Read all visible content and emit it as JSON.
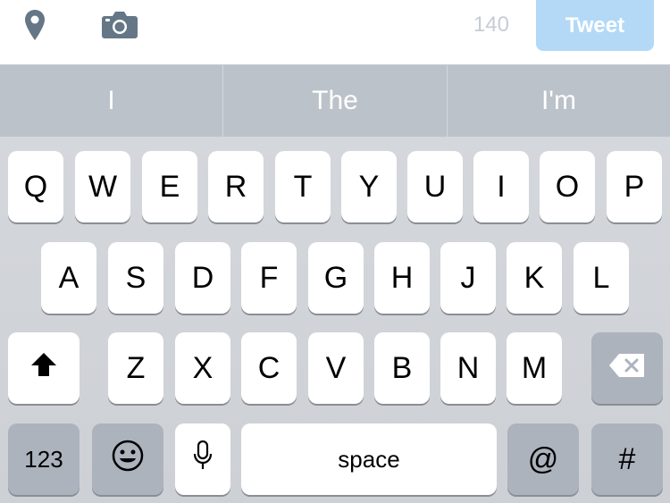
{
  "toolbar": {
    "location_icon": "location-pin-icon",
    "camera_icon": "camera-icon",
    "char_count": "140",
    "tweet_label": "Tweet",
    "tweet_color": "#b3d9f7"
  },
  "suggestions": [
    "I",
    "The",
    "I'm"
  ],
  "keyboard": {
    "row1": [
      "Q",
      "W",
      "E",
      "R",
      "T",
      "Y",
      "U",
      "I",
      "O",
      "P"
    ],
    "row2": [
      "A",
      "S",
      "D",
      "F",
      "G",
      "H",
      "J",
      "K",
      "L"
    ],
    "row3": [
      "Z",
      "X",
      "C",
      "V",
      "B",
      "N",
      "M"
    ],
    "shift_icon": "shift-arrow-icon",
    "delete_icon": "delete-backspace-icon",
    "numbers_label": "123",
    "emoji_icon": "emoji-icon",
    "mic_icon": "microphone-icon",
    "space_label": "space",
    "at_label": "@",
    "hash_label": "#"
  }
}
